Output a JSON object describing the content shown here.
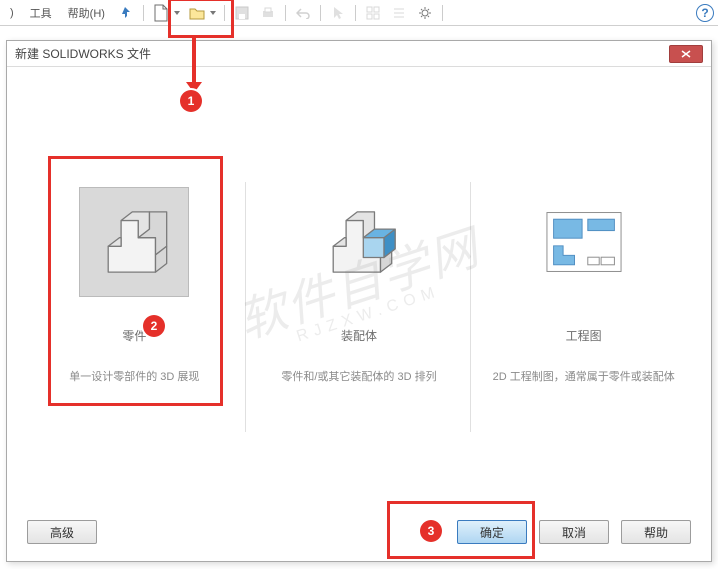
{
  "toolbar": {
    "menu_edge": ")",
    "menu_tools": "工具",
    "menu_help": "帮助(H)"
  },
  "dialog": {
    "title": "新建 SOLIDWORKS 文件",
    "options": {
      "part": {
        "title": "零件",
        "desc": "单一设计零部件的 3D 展现"
      },
      "assembly": {
        "title": "装配体",
        "desc": "零件和/或其它装配体的 3D 排列"
      },
      "drawing": {
        "title": "工程图",
        "desc": "2D 工程制图，通常属于零件或装配体"
      }
    },
    "buttons": {
      "advanced": "高级",
      "ok": "确定",
      "cancel": "取消",
      "help": "帮助"
    }
  },
  "annotations": {
    "step1": "1",
    "step2": "2",
    "step3": "3"
  },
  "watermark": {
    "main": "软件自学网",
    "sub": "RJZXW.COM"
  },
  "help_glyph": "?"
}
